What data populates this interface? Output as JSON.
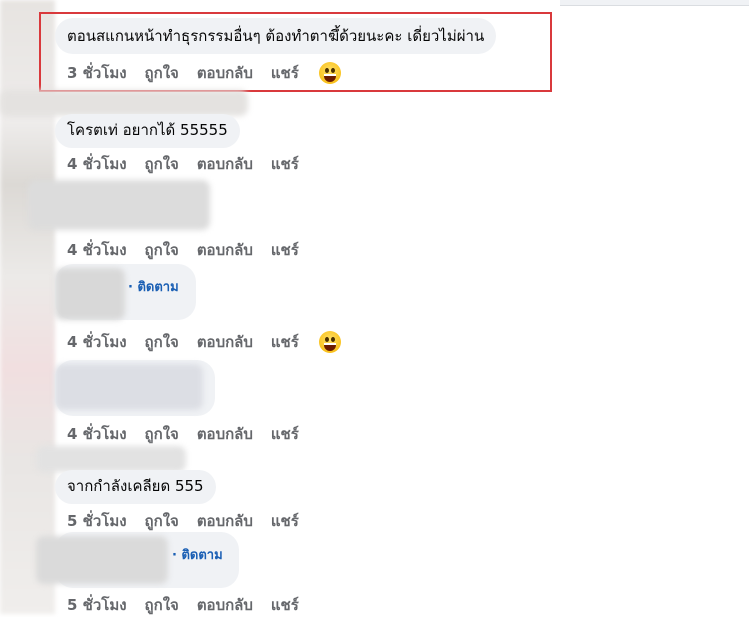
{
  "comments": [
    {
      "text": "ตอนสแกนหน้าทำธุรกรรมอื่นๆ ต้องทำตาฆึ้ด้วยนะคะ เดี่ยวไม่ผ่าน",
      "time": "3 ชั่วโมง",
      "like": "ถูกใจ",
      "reply": "ตอบกลับ",
      "share": "แชร์",
      "reaction": "laughing-emoji"
    },
    {
      "text": "โครตเท่ อยากได้ 55555",
      "time": "4 ชั่วโมง",
      "like": "ถูกใจ",
      "reply": "ตอบกลับ",
      "share": "แชร์"
    },
    {
      "text": "",
      "time": "4 ชั่วโมง",
      "like": "ถูกใจ",
      "reply": "ตอบกลับ",
      "share": "แชร์"
    },
    {
      "follow": "· ติดตาม",
      "time": "4 ชั่วโมง",
      "like": "ถูกใจ",
      "reply": "ตอบกลับ",
      "share": "แชร์",
      "reaction": "laughing-emoji"
    },
    {
      "text": "",
      "time": "4 ชั่วโมง",
      "like": "ถูกใจ",
      "reply": "ตอบกลับ",
      "share": "แชร์"
    },
    {
      "text": "จากกำลังเคลียด 555",
      "time": "5 ชั่วโมง",
      "like": "ถูกใจ",
      "reply": "ตอบกลับ",
      "share": "แชร์"
    },
    {
      "follow": "· ติดตาม",
      "time": "5 ชั่วโมง",
      "like": "ถูกใจ",
      "reply": "ตอบกลับ",
      "share": "แชร์"
    }
  ],
  "colors": {
    "highlight": "#d9393c",
    "link": "#1a5fb4",
    "meta": "#65676b",
    "bubble": "#f0f2f5"
  }
}
